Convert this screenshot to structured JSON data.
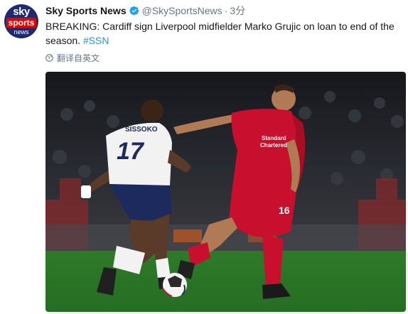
{
  "account": {
    "avatar_lines": [
      "sky",
      "sports",
      "news"
    ],
    "name": "Sky Sports News",
    "handle": "@SkySportsNews",
    "separator": "·",
    "time": "3分",
    "verified_icon": "verified-badge-icon"
  },
  "tweet": {
    "text": "BREAKING: Cardiff sign Liverpool midfielder Marko Grujic on loan to end of the season. ",
    "hashtag": "#SSN"
  },
  "translate": {
    "icon": "globe-icon",
    "label": "翻译自英文"
  },
  "media": {
    "description_icon": "football-photo",
    "left_shirt_name": "SISSOKO",
    "left_shirt_number": "17",
    "right_shirt_sponsor_line1": "Standard",
    "right_shirt_sponsor_line2": "Chartered",
    "right_shorts_number": "16"
  },
  "colors": {
    "brand_blue": "#1d2a72",
    "brand_red": "#e10600",
    "link": "#1b95e0",
    "muted": "#657786"
  }
}
